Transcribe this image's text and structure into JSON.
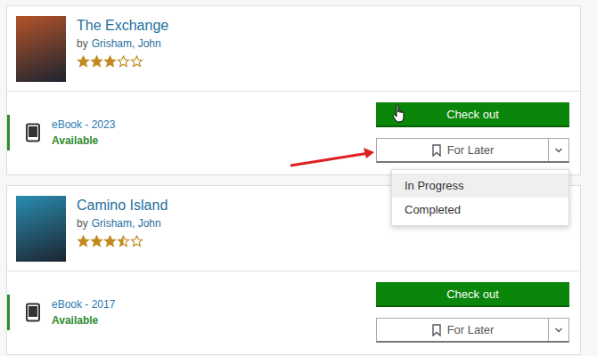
{
  "books": [
    {
      "title": "The Exchange",
      "by": "by",
      "author": "Grisham, John",
      "stars": 3,
      "cover_color": "#b4532a",
      "format": "eBook - 2023",
      "availability": "Available",
      "checkout": "Check out",
      "later": "For Later",
      "checkout_hovered": true,
      "menu_open": true,
      "menu": [
        {
          "label": "In Progress",
          "selected": true
        },
        {
          "label": "Completed",
          "selected": false
        }
      ]
    },
    {
      "title": "Camino Island",
      "by": "by",
      "author": "Grisham, John",
      "stars": 3.5,
      "cover_color": "#2a8db0",
      "format": "eBook - 2017",
      "availability": "Available",
      "checkout": "Check out",
      "later": "For Later",
      "checkout_hovered": false,
      "menu_open": false,
      "menu": []
    }
  ]
}
